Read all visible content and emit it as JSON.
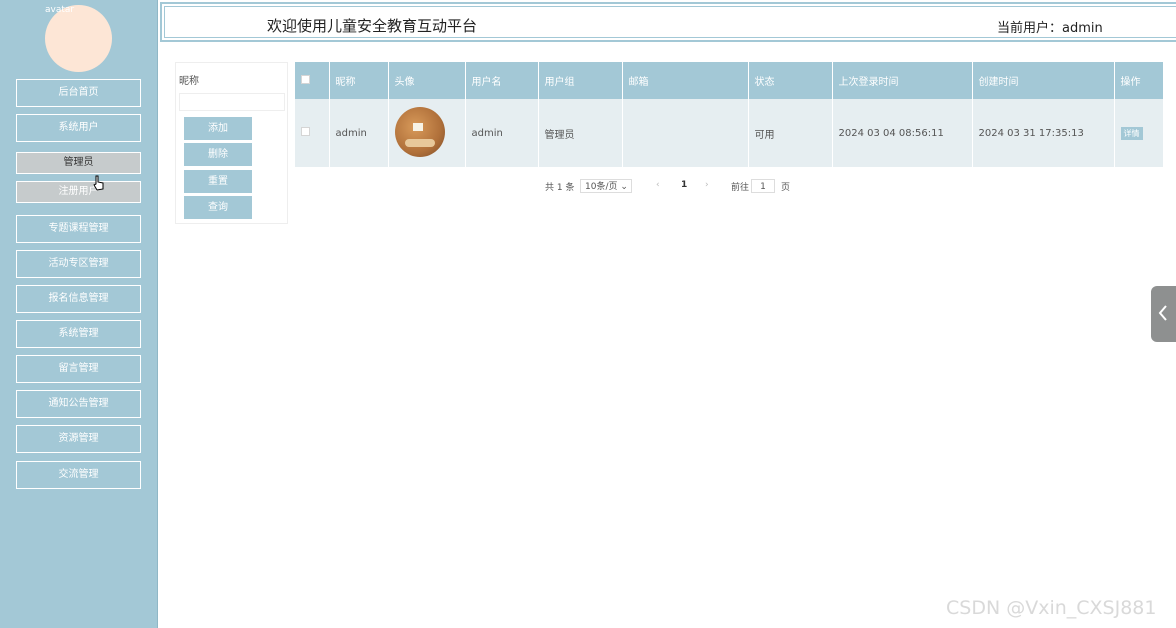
{
  "sidebar": {
    "avatar_alt": "avatar",
    "items": [
      {
        "label": "后台首页"
      },
      {
        "label": "系统用户"
      },
      {
        "label": "管理员"
      },
      {
        "label": "注册用户"
      },
      {
        "label": "专题课程管理"
      },
      {
        "label": "活动专区管理"
      },
      {
        "label": "报名信息管理"
      },
      {
        "label": "系统管理"
      },
      {
        "label": "留言管理"
      },
      {
        "label": "通知公告管理"
      },
      {
        "label": "资源管理"
      },
      {
        "label": "交流管理"
      }
    ]
  },
  "header": {
    "title": "欢迎使用儿童安全教育互动平台",
    "current_user": "当前用户：admin"
  },
  "search": {
    "label": "昵称",
    "value": "",
    "buttons": {
      "add": "添加",
      "delete": "删除",
      "reset": "重置",
      "query": "查询"
    }
  },
  "table": {
    "columns": [
      "",
      "昵称",
      "头像",
      "用户名",
      "用户组",
      "邮箱",
      "状态",
      "上次登录时间",
      "创建时间",
      "操作"
    ],
    "rows": [
      {
        "nickname": "admin",
        "username": "admin",
        "group": "管理员",
        "email": "",
        "status": "可用",
        "last_login": "2024 03 04 08:56:11",
        "created": "2024 03 31 17:35:13",
        "action": "详情"
      }
    ]
  },
  "pagination": {
    "total": "共 1 条",
    "page_size": "10条/页",
    "prev": "‹",
    "current_page": "1",
    "next": "›",
    "goto_label": "前往",
    "goto_value": "1",
    "page_suffix": "页"
  },
  "watermark": "CSDN @Vxin_CXSJ881",
  "colors": {
    "accent": "#a3c8d6",
    "tab": "#8e9090"
  }
}
